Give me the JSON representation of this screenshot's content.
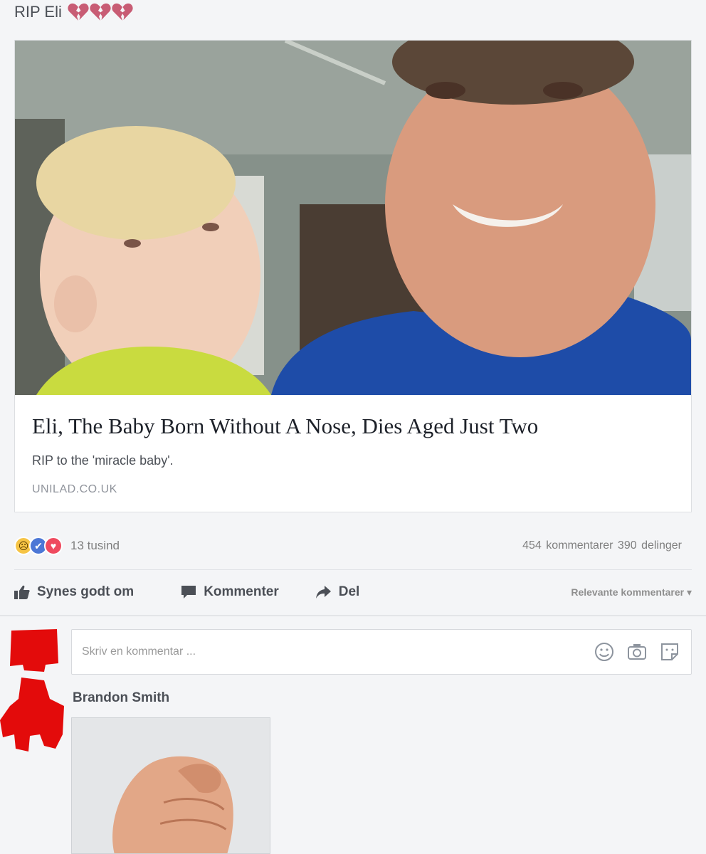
{
  "post": {
    "text": "RIP Eli"
  },
  "link_card": {
    "title": "Eli, The Baby Born Without A Nose, Dies Aged Just Two",
    "description": "RIP to the 'miracle baby'.",
    "domain": "UNILAD.CO.UK"
  },
  "reactions": {
    "count": "13 tusind",
    "comments_count": "454 kommentarer",
    "shares_count": "390 delinger"
  },
  "actions": {
    "like": "Synes godt om",
    "comment": "Kommenter",
    "share": "Del",
    "sort": "Relevante kommentarer ▾"
  },
  "comment_box": {
    "placeholder": "Skriv en kommentar ..."
  },
  "comment": {
    "author": "Brandon Smith"
  },
  "colors": {
    "reaction_sad": "#f6c445",
    "reaction_like": "#4c77d6",
    "reaction_love": "#ef4a5f",
    "censor_red": "#e30b0b"
  }
}
